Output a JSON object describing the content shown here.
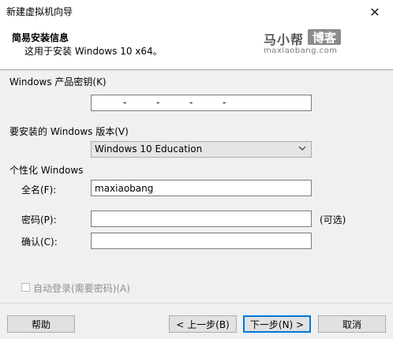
{
  "window": {
    "title": "新建虚拟机向导",
    "close_glyph": "✕"
  },
  "header": {
    "title": "简易安装信息",
    "subtitle": "这用于安装 Windows 10 x64。"
  },
  "watermark": {
    "cn": "马小帮",
    "box": "博客",
    "en": "maxiaobang.com"
  },
  "product_key": {
    "label": "Windows 产品密钥(K)",
    "separator": "-"
  },
  "version": {
    "label": "要安装的 Windows 版本(V)",
    "selected": "Windows 10 Education"
  },
  "personalize": {
    "label": "个性化 Windows",
    "fullname_label": "全名(F):",
    "fullname_value": "maxiaobang",
    "password_label": "密码(P):",
    "password_value": "",
    "optional_note": "(可选)",
    "confirm_label": "确认(C):",
    "confirm_value": ""
  },
  "autologin": {
    "label": "自动登录(需要密码)(A)",
    "checked": false
  },
  "buttons": {
    "help": "帮助",
    "back": "< 上一步(B)",
    "next": "下一步(N) >",
    "cancel": "取消"
  }
}
